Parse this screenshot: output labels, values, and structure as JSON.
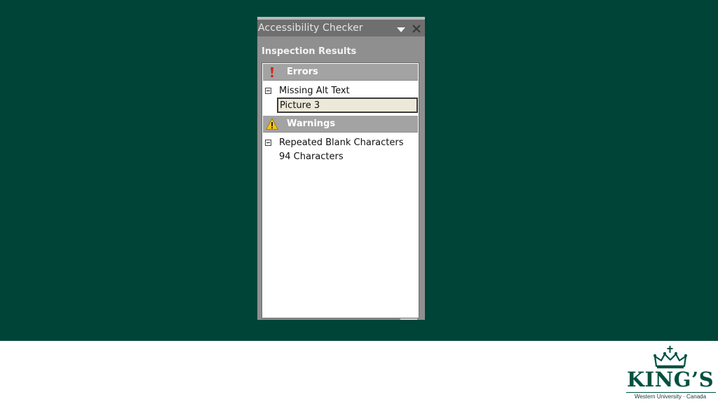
{
  "pane": {
    "title": "Accessibility Checker",
    "heading": "Inspection Results",
    "icons": {
      "menu": "triangle-down-icon",
      "close": "close-icon",
      "error": "exclamation-icon",
      "warning": "warning-triangle-icon"
    },
    "sections": {
      "errors": {
        "label": "Errors",
        "group": "Missing Alt Text",
        "item": "Picture 3"
      },
      "warnings": {
        "label": "Warnings",
        "group": "Repeated Blank Characters",
        "item": "94 Characters"
      }
    }
  },
  "logo": {
    "name": "KING’S",
    "subtitle": "Western University · Canada"
  },
  "colors": {
    "slide_background": "#004437",
    "logo_green": "#005140",
    "pane_gray": "#8f8f8f",
    "section_header": "#a3a3a3",
    "selection_fill": "#ece9d8"
  }
}
